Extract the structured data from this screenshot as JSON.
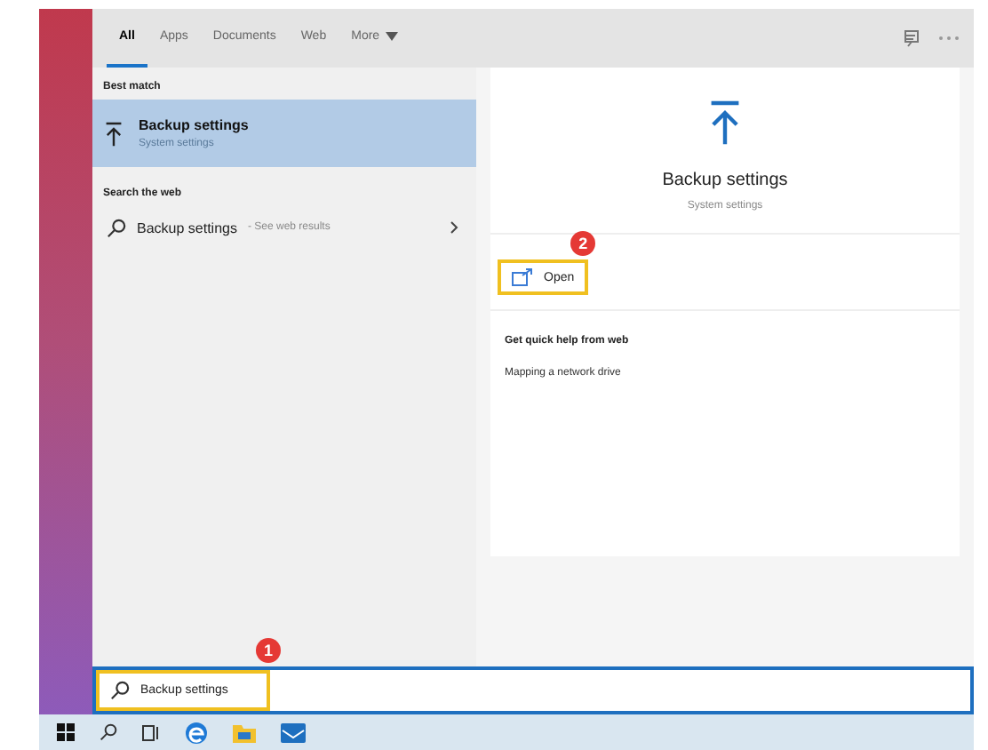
{
  "tabs": [
    {
      "label": "All",
      "selected": true
    },
    {
      "label": "Apps",
      "selected": false
    },
    {
      "label": "Documents",
      "selected": false
    },
    {
      "label": "Web",
      "selected": false
    },
    {
      "label": "More",
      "selected": false,
      "kind": "dropdown"
    }
  ],
  "best_match": {
    "heading": "Best match",
    "result": {
      "title": "Backup settings",
      "subtitle": "System settings",
      "selected": true
    }
  },
  "web": {
    "heading": "Search the web",
    "result": {
      "title": "Backup settings",
      "suffix": "- See web results"
    }
  },
  "detail": {
    "title": "Backup settings",
    "subtitle": "System settings",
    "actions": [
      {
        "label": "Open",
        "highlighted": true,
        "badge": "2"
      }
    ],
    "help_heading": "Get quick help from web",
    "help_links": [
      "Mapping a network drive"
    ]
  },
  "search_box": {
    "value": "Backup settings",
    "highlighted": true,
    "badge": "1"
  }
}
